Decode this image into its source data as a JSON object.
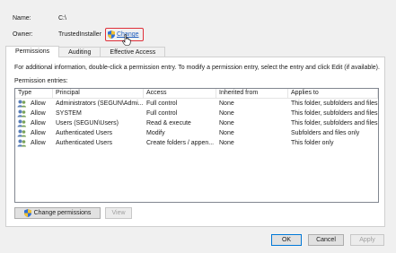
{
  "header": {
    "name_label": "Name:",
    "name_value": "C:\\",
    "owner_label": "Owner:",
    "owner_value": "TrustedInstaller",
    "change_link": "Change"
  },
  "tabs": [
    {
      "label": "Permissions",
      "active": true
    },
    {
      "label": "Auditing",
      "active": false
    },
    {
      "label": "Effective Access",
      "active": false
    }
  ],
  "permissions": {
    "description": "For additional information, double-click a permission entry. To modify a permission entry, select the entry and click Edit (if available).",
    "entries_label": "Permission entries:",
    "columns": [
      "Type",
      "Principal",
      "Access",
      "Inherited from",
      "Applies to"
    ],
    "rows": [
      {
        "type": "Allow",
        "principal": "Administrators (SEGUN\\Admi...",
        "access": "Full control",
        "inherited": "None",
        "applies": "This folder, subfolders and files"
      },
      {
        "type": "Allow",
        "principal": "SYSTEM",
        "access": "Full control",
        "inherited": "None",
        "applies": "This folder, subfolders and files"
      },
      {
        "type": "Allow",
        "principal": "Users (SEGUN\\Users)",
        "access": "Read & execute",
        "inherited": "None",
        "applies": "This folder, subfolders and files"
      },
      {
        "type": "Allow",
        "principal": "Authenticated Users",
        "access": "Modify",
        "inherited": "None",
        "applies": "Subfolders and files only"
      },
      {
        "type": "Allow",
        "principal": "Authenticated Users",
        "access": "Create folders / appen...",
        "inherited": "None",
        "applies": "This folder only"
      }
    ],
    "change_permissions_button": "Change permissions",
    "view_button": "View"
  },
  "footer": {
    "ok": "OK",
    "cancel": "Cancel",
    "apply": "Apply"
  },
  "colors": {
    "link": "#1f5fbf",
    "highlight_border": "#e0303a",
    "focus_border": "#0078d7"
  }
}
